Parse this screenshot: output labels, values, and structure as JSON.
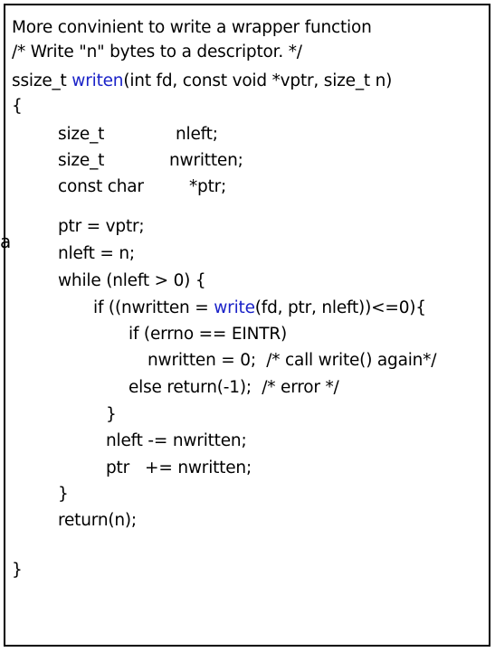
{
  "heading": "More convinient to write a wrapper function",
  "comment": "/* Write \"n\" bytes to a descriptor. */",
  "signature": {
    "ret_type": "ssize_t ",
    "func_name": "writen",
    "params": "(int fd, const void *vptr, size_t n)"
  },
  "open_brace": "{",
  "decl_1": {
    "type": "size_t",
    "name": "nleft;"
  },
  "decl_2": {
    "type": "size_t",
    "name": "nwritten;"
  },
  "decl_3": {
    "type": "const char",
    "name": "*ptr;"
  },
  "body": {
    "l1": "ptr = vptr;",
    "l2": "nleft = n;",
    "l3": "while (nleft > 0) {",
    "l4_pre": "if ((nwritten = ",
    "l4_call": "write",
    "l4_post": "(fd, ptr, nleft))<=0){",
    "l5": "if (errno == EINTR)",
    "l6": "nwritten = 0;  /* call write() again*/",
    "l7": "else return(-1);  /* error */",
    "l8": "}",
    "l9": "nleft -= nwritten;",
    "l10": "ptr   += nwritten;",
    "l11": "}",
    "l12": "return(n);"
  },
  "close_brace": "}",
  "stray_char": "a",
  "colors": {
    "keyword": "#1a22c8",
    "text": "#000000",
    "border": "#000000"
  }
}
